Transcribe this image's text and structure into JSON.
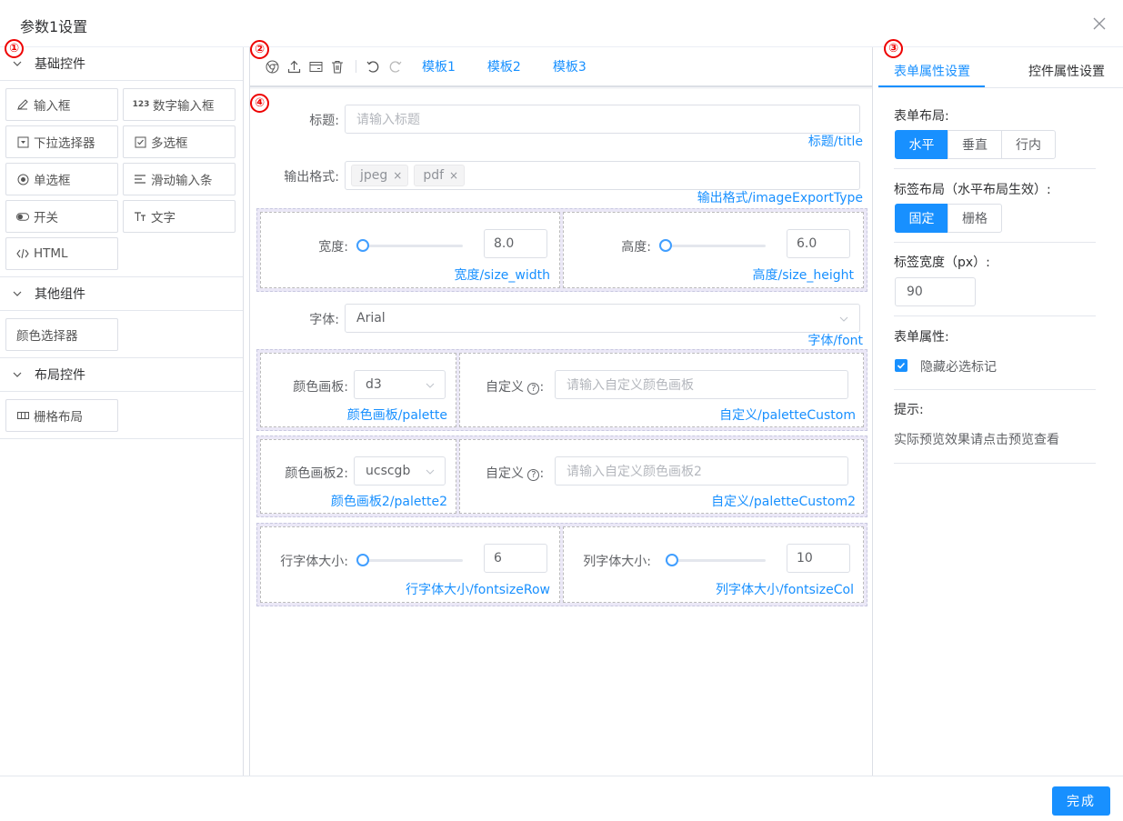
{
  "dialog": {
    "title": "参数1设置"
  },
  "markers": [
    "①",
    "②",
    "③",
    "④"
  ],
  "left_panel": {
    "groups": [
      {
        "title": "基础控件",
        "items": [
          {
            "label": "输入框",
            "icon": "pencil-icon"
          },
          {
            "label": "数字输入框",
            "icon": "number-123-icon",
            "icon_text": "123"
          },
          {
            "label": "下拉选择器",
            "icon": "dropdown-icon"
          },
          {
            "label": "多选框",
            "icon": "checkbox-icon"
          },
          {
            "label": "单选框",
            "icon": "radio-icon"
          },
          {
            "label": "滑动输入条",
            "icon": "slider-lines-icon"
          },
          {
            "label": "开关",
            "icon": "toggle-icon"
          },
          {
            "label": "文字",
            "icon": "text-icon"
          },
          {
            "label": "HTML",
            "icon": "code-icon"
          }
        ]
      },
      {
        "title": "其他组件",
        "items": [
          {
            "label": "颜色选择器"
          }
        ]
      },
      {
        "title": "布局控件",
        "items": [
          {
            "label": "栅格布局",
            "icon": "grid-icon"
          }
        ]
      }
    ]
  },
  "toolbar": {
    "icons": [
      "chrome-preview-icon",
      "upload-icon",
      "card-icon",
      "trash-icon",
      "undo-icon",
      "redo-icon"
    ],
    "templates": [
      "模板1",
      "模板2",
      "模板3"
    ]
  },
  "form": {
    "title": {
      "label": "标题:",
      "placeholder": "请输入标题",
      "key": "标题/title"
    },
    "format": {
      "label": "输出格式:",
      "tags": [
        "jpeg",
        "pdf"
      ],
      "tag_close": "×",
      "key": "输出格式/imageExportType"
    },
    "width": {
      "label": "宽度:",
      "value": "8.0",
      "slider_pct": 0.0,
      "key": "宽度/size_width"
    },
    "height": {
      "label": "高度:",
      "value": "6.0",
      "slider_pct": 0.0,
      "key": "高度/size_height"
    },
    "font": {
      "label": "字体:",
      "value": "Arial",
      "key": "字体/font"
    },
    "palette": {
      "label": "颜色画板:",
      "value": "d3",
      "key": "颜色画板/palette"
    },
    "palette_custom": {
      "label": "自定义",
      "help": "?",
      "colon": ":",
      "placeholder": "请输入自定义颜色画板",
      "key": "自定义/paletteCustom"
    },
    "palette2": {
      "label": "颜色画板2:",
      "value": "ucscgb",
      "key": "颜色画板2/palette2"
    },
    "palette_custom2": {
      "label": "自定义",
      "help": "?",
      "colon": ":",
      "placeholder": "请输入自定义颜色画板2",
      "key": "自定义/paletteCustom2"
    },
    "fontsize_row": {
      "label": "行字体大小:",
      "value": "6",
      "slider_pct": 0.0,
      "key": "行字体大小/fontsizeRow"
    },
    "fontsize_col": {
      "label": "列字体大小:",
      "value": "10",
      "slider_pct": 0.06,
      "key": "列字体大小/fontsizeCol"
    }
  },
  "right_panel": {
    "tabs": [
      "表单属性设置",
      "控件属性设置"
    ],
    "active_tab": 0,
    "form_layout": {
      "label": "表单布局:",
      "options": [
        "水平",
        "垂直",
        "行内"
      ],
      "selected": 0
    },
    "label_layout": {
      "label": "标签布局（水平布局生效）:",
      "options": [
        "固定",
        "栅格"
      ],
      "selected": 0
    },
    "label_width": {
      "label": "标签宽度（px）:",
      "value": "90"
    },
    "form_attr": {
      "label": "表单属性:",
      "checkbox_label": "隐藏必选标记",
      "checked": true
    },
    "tip": {
      "label": "提示:",
      "text": "实际预览效果请点击预览查看"
    }
  },
  "footer": {
    "done_label": "完成"
  },
  "colors": {
    "accent": "#1890ff",
    "marker": "#e00000",
    "grid_bg": "#ebe8f7"
  }
}
